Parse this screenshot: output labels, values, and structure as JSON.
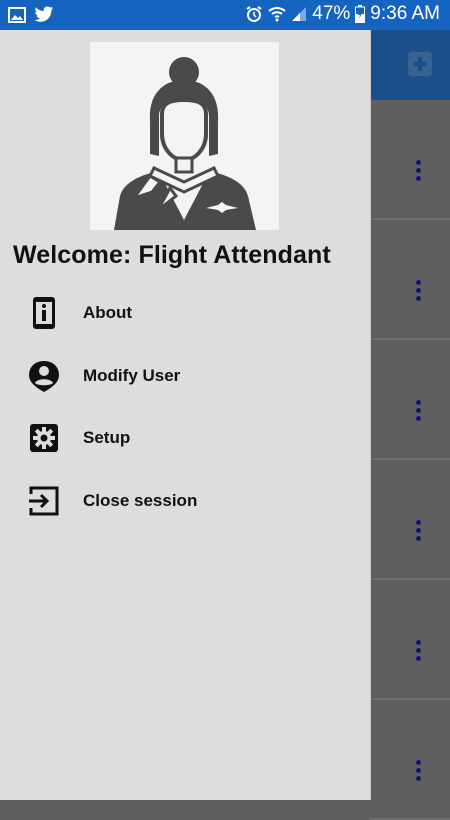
{
  "status_bar": {
    "battery": "47%",
    "time": "9:36 AM",
    "icons": [
      "image-icon",
      "twitter-icon",
      "alarm-icon",
      "wifi-icon",
      "signal-icon",
      "battery-icon"
    ]
  },
  "drawer": {
    "welcome": "Welcome: Flight Attendant",
    "avatar_icon": "flight-attendant-avatar",
    "items": [
      {
        "label": "About",
        "icon": "info-phone-icon"
      },
      {
        "label": "Modify User",
        "icon": "user-pin-icon"
      },
      {
        "label": "Setup",
        "icon": "gear-icon"
      },
      {
        "label": "Close session",
        "icon": "exit-icon"
      }
    ]
  },
  "background_app": {
    "add_icon": "add-icon",
    "row_menu_icon": "more-vert-icon",
    "colors": {
      "appbar": "#1a4f8c",
      "status_bar": "#1565c0",
      "dots": "#14146e"
    }
  }
}
